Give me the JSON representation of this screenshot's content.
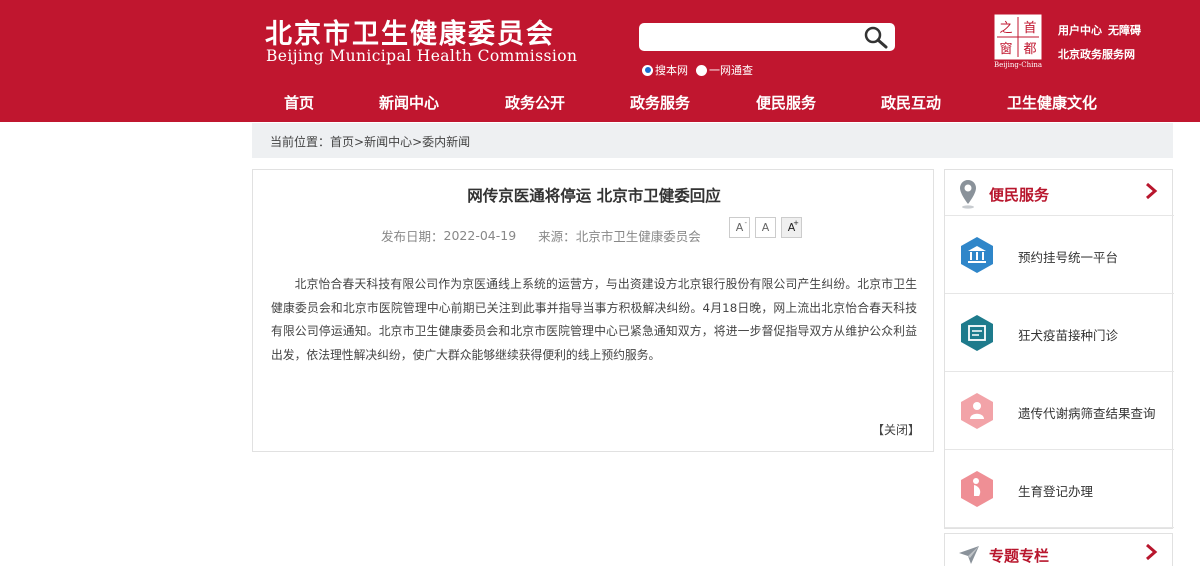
{
  "header": {
    "logo_cn": "北京市卫生健康委员会",
    "logo_en": "Beijing Municipal Health Commission",
    "search": {
      "placeholder": "",
      "options": [
        "搜本网",
        "一网通查"
      ],
      "selected": "搜本网"
    },
    "emblem_text": "Beijing-China",
    "emblem_chars": [
      "之",
      "首",
      "窗",
      "都"
    ],
    "top_links": [
      "用户中心",
      "无障碍",
      "北京政务服务网"
    ]
  },
  "nav": {
    "items": [
      "首页",
      "新闻中心",
      "政务公开",
      "政务服务",
      "便民服务",
      "政民互动",
      "卫生健康文化"
    ]
  },
  "breadcrumb": {
    "label": "当前位置：",
    "path": "首页>新闻中心>委内新闻"
  },
  "article": {
    "title": "网传京医通将停运 北京市卫健委回应",
    "date_label": "发布日期：",
    "date": "2022-04-19",
    "source_label": "来源：",
    "source": "北京市卫生健康委员会",
    "font_buttons": [
      "A",
      "A",
      "A"
    ],
    "body": "北京怡合春天科技有限公司作为京医通线上系统的运营方，与出资建设方北京银行股份有限公司产生纠纷。北京市卫生健康委员会和北京市医院管理中心前期已关注到此事并指导当事方积极解决纠纷。4月18日晚，网上流出北京怡合春天科技有限公司停运通知。北京市卫生健康委员会和北京市医院管理中心已紧急通知双方，将进一步督促指导双方从维护公众利益出发，依法理性解决纠纷，使广大群众能够继续获得便利的线上预约服务。",
    "close": "【关闭】"
  },
  "sidebar": {
    "title": "便民服务",
    "items": [
      {
        "label": "预约挂号统一平台",
        "icon": "bank-icon",
        "color": "#2f86c9"
      },
      {
        "label": "狂犬疫苗接种门诊",
        "icon": "syringe-icon",
        "color": "#1e7b8c"
      },
      {
        "label": "遗传代谢病筛查结果查询",
        "icon": "baby-icon",
        "color": "#f2a3a8"
      },
      {
        "label": "生育登记办理",
        "icon": "pregnancy-icon",
        "color": "#ef8f95"
      }
    ]
  },
  "sidebar2": {
    "title": "专题专栏"
  },
  "colors": {
    "brand_red": "#c0162f",
    "accent_red": "#b8162d",
    "breadcrumb_bg": "#eef0f2"
  }
}
